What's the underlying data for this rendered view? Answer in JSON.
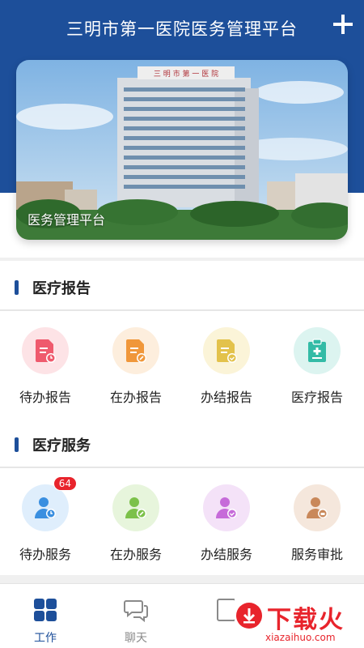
{
  "header": {
    "title": "三明市第一医院医务管理平台",
    "add_icon": "plus-icon"
  },
  "banner": {
    "caption": "医务管理平台",
    "building_sign": "三 明 市 第 一 医 院"
  },
  "sections": [
    {
      "title": "医疗报告",
      "items": [
        {
          "label": "待办报告",
          "icon": "report-clock-icon",
          "color": "#ef5a6d",
          "bg": "#fde3e6"
        },
        {
          "label": "在办报告",
          "icon": "report-edit-icon",
          "color": "#f0973a",
          "bg": "#fdeedd"
        },
        {
          "label": "办结报告",
          "icon": "report-check-icon",
          "color": "#e3c24b",
          "bg": "#fbf4d8"
        },
        {
          "label": "医疗报告",
          "icon": "clipboard-medical-icon",
          "color": "#33bba6",
          "bg": "#dcf4f0"
        }
      ]
    },
    {
      "title": "医疗服务",
      "items": [
        {
          "label": "待办服务",
          "icon": "user-clock-icon",
          "color": "#3a8fe0",
          "bg": "#dfeefc",
          "badge": "64"
        },
        {
          "label": "在办服务",
          "icon": "user-edit-icon",
          "color": "#7cc14a",
          "bg": "#e7f5dc"
        },
        {
          "label": "办结服务",
          "icon": "user-check-icon",
          "color": "#c66bd9",
          "bg": "#f4e2f8"
        },
        {
          "label": "服务审批",
          "icon": "user-approve-icon",
          "color": "#c9885a",
          "bg": "#f5e7dc"
        }
      ]
    }
  ],
  "tabbar": {
    "tabs": [
      {
        "label": "工作",
        "icon": "grid-icon",
        "active": true
      },
      {
        "label": "聊天",
        "icon": "chat-icon",
        "active": false
      },
      {
        "label": "",
        "icon": "contacts-icon",
        "active": false
      },
      {
        "label": "",
        "icon": "profile-icon",
        "active": false
      }
    ]
  },
  "watermark": {
    "text": "下载火",
    "url": "xiazaihuo.com"
  },
  "colors": {
    "primary": "#1d4f9a",
    "badge": "#e8242c"
  }
}
